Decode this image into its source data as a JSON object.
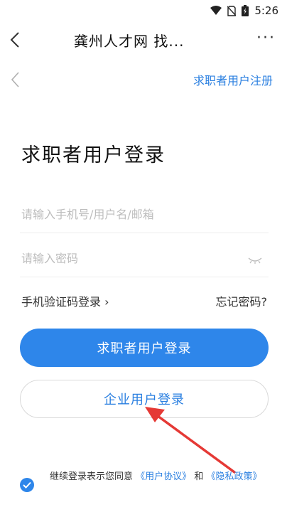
{
  "status_bar": {
    "time": "5:26"
  },
  "app_bar": {
    "title": "龚州人才网 找...",
    "more": "···"
  },
  "header": {
    "register_link": "求职者用户注册"
  },
  "page": {
    "title": "求职者用户登录"
  },
  "form": {
    "username_placeholder": "请输入手机号/用户名/邮箱",
    "password_placeholder": "请输入密码",
    "sms_login": "手机验证码登录 ›",
    "forgot_password": "忘记密码?"
  },
  "buttons": {
    "jobseeker_login": "求职者用户登录",
    "enterprise_login": "企业用户登录"
  },
  "agreement": {
    "prefix": "继续登录表示您同意",
    "user_agreement": "《用户协议》",
    "and": "和",
    "privacy_policy": "《隐私政策》"
  },
  "annotation": {
    "arrow_color": "#e53935"
  },
  "colors": {
    "accent": "#2e86ea",
    "link": "#2a7fe0"
  }
}
